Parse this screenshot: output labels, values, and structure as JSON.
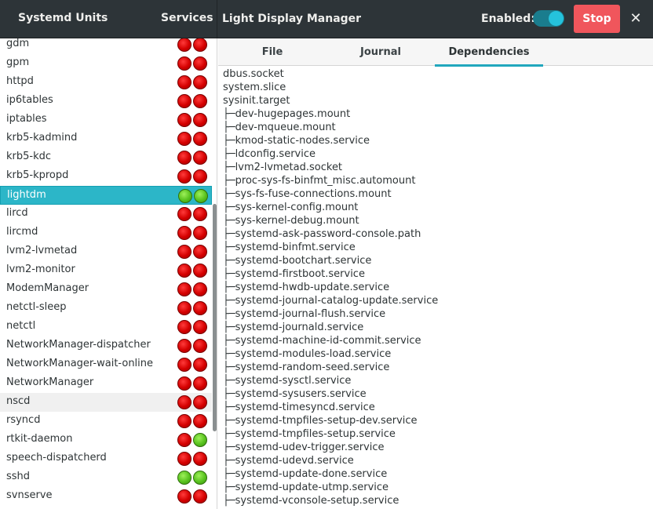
{
  "header": {
    "app_title": "Systemd Units",
    "services_label": "Services",
    "unit_title": "Light Display Manager",
    "enabled_label": "Enabled:",
    "enabled_state": true,
    "stop_label": "Stop",
    "close_glyph": "✕",
    "accent_color": "#2cb6c8",
    "stop_color": "#f0565c"
  },
  "services": [
    {
      "name": "gdm",
      "status": [
        "red",
        "red"
      ]
    },
    {
      "name": "gpm",
      "status": [
        "red",
        "red"
      ]
    },
    {
      "name": "httpd",
      "status": [
        "red",
        "red"
      ]
    },
    {
      "name": "ip6tables",
      "status": [
        "red",
        "red"
      ]
    },
    {
      "name": "iptables",
      "status": [
        "red",
        "red"
      ]
    },
    {
      "name": "krb5-kadmind",
      "status": [
        "red",
        "red"
      ]
    },
    {
      "name": "krb5-kdc",
      "status": [
        "red",
        "red"
      ]
    },
    {
      "name": "krb5-kpropd",
      "status": [
        "red",
        "red"
      ]
    },
    {
      "name": "lightdm",
      "status": [
        "green",
        "green"
      ],
      "selected": true
    },
    {
      "name": "lircd",
      "status": [
        "red",
        "red"
      ]
    },
    {
      "name": "lircmd",
      "status": [
        "red",
        "red"
      ]
    },
    {
      "name": "lvm2-lvmetad",
      "status": [
        "red",
        "red"
      ]
    },
    {
      "name": "lvm2-monitor",
      "status": [
        "red",
        "red"
      ]
    },
    {
      "name": "ModemManager",
      "status": [
        "red",
        "red"
      ]
    },
    {
      "name": "netctl-sleep",
      "status": [
        "red",
        "red"
      ]
    },
    {
      "name": "netctl",
      "status": [
        "red",
        "red"
      ]
    },
    {
      "name": "NetworkManager-dispatcher",
      "status": [
        "red",
        "red"
      ]
    },
    {
      "name": "NetworkManager-wait-online",
      "status": [
        "red",
        "red"
      ]
    },
    {
      "name": "NetworkManager",
      "status": [
        "red",
        "red"
      ]
    },
    {
      "name": "nscd",
      "status": [
        "red",
        "red"
      ],
      "hover": true
    },
    {
      "name": "rsyncd",
      "status": [
        "red",
        "red"
      ]
    },
    {
      "name": "rtkit-daemon",
      "status": [
        "red",
        "green"
      ]
    },
    {
      "name": "speech-dispatcherd",
      "status": [
        "red",
        "red"
      ]
    },
    {
      "name": "sshd",
      "status": [
        "green",
        "green"
      ]
    },
    {
      "name": "svnserve",
      "status": [
        "red",
        "red"
      ]
    }
  ],
  "tabs": [
    {
      "label": "File",
      "active": false
    },
    {
      "label": "Journal",
      "active": false
    },
    {
      "label": "Dependencies",
      "active": true
    }
  ],
  "dependencies": [
    "dbus.socket",
    "system.slice",
    "sysinit.target",
    "├─dev-hugepages.mount",
    "├─dev-mqueue.mount",
    "├─kmod-static-nodes.service",
    "├─ldconfig.service",
    "├─lvm2-lvmetad.socket",
    "├─proc-sys-fs-binfmt_misc.automount",
    "├─sys-fs-fuse-connections.mount",
    "├─sys-kernel-config.mount",
    "├─sys-kernel-debug.mount",
    "├─systemd-ask-password-console.path",
    "├─systemd-binfmt.service",
    "├─systemd-bootchart.service",
    "├─systemd-firstboot.service",
    "├─systemd-hwdb-update.service",
    "├─systemd-journal-catalog-update.service",
    "├─systemd-journal-flush.service",
    "├─systemd-journald.service",
    "├─systemd-machine-id-commit.service",
    "├─systemd-modules-load.service",
    "├─systemd-random-seed.service",
    "├─systemd-sysctl.service",
    "├─systemd-sysusers.service",
    "├─systemd-timesyncd.service",
    "├─systemd-tmpfiles-setup-dev.service",
    "├─systemd-tmpfiles-setup.service",
    "├─systemd-udev-trigger.service",
    "├─systemd-udevd.service",
    "├─systemd-update-done.service",
    "├─systemd-update-utmp.service",
    "├─systemd-vconsole-setup.service"
  ]
}
